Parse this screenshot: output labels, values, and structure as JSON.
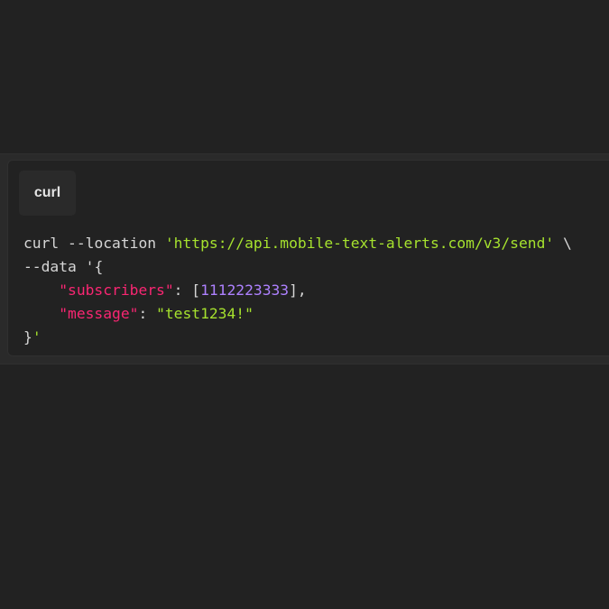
{
  "tab": {
    "label": "curl"
  },
  "code": {
    "line1": {
      "cmd": "curl",
      "flag": "--location",
      "url": "'https://api.mobile-text-alerts.com/v3/send'",
      "cont": " \\"
    },
    "line2": {
      "flag": "--data",
      "open": "'{"
    },
    "line3": {
      "key": "\"subscribers\"",
      "colon": ": [",
      "number": "1112223333",
      "close": "],"
    },
    "line4": {
      "key": "\"message\"",
      "colon": ": ",
      "value": "\"test1234!\""
    },
    "line5": {
      "brace": "}",
      "quote": "'"
    }
  },
  "colors": {
    "background": "#222222",
    "string": "#a6e22e",
    "key": "#f92672",
    "number": "#ae81ff",
    "text": "#d6d6d6"
  }
}
